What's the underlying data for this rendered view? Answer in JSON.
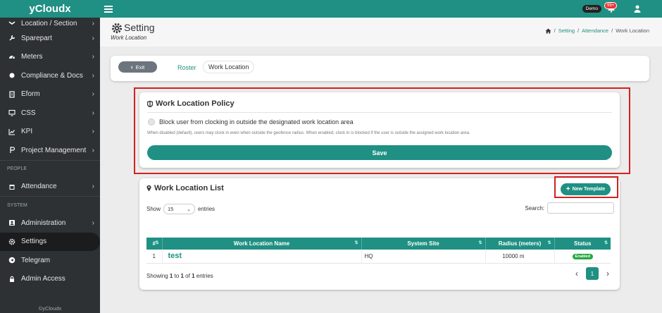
{
  "app": {
    "brand": "yCloudx",
    "copyright": "©yCloudx"
  },
  "topbar": {
    "demo_label": "Demo",
    "notif_count": "99+"
  },
  "sidebar": {
    "items": [
      {
        "label": "Location / Section",
        "icon": "layers-icon"
      },
      {
        "label": "Sparepart",
        "icon": "wrench-icon"
      },
      {
        "label": "Meters",
        "icon": "gauge-icon"
      },
      {
        "label": "Compliance & Docs",
        "icon": "circle-icon"
      },
      {
        "label": "Eform",
        "icon": "form-icon"
      },
      {
        "label": "CSS",
        "icon": "monitor-icon"
      },
      {
        "label": "KPI",
        "icon": "chart-icon"
      },
      {
        "label": "Project Management",
        "icon": "project-icon"
      }
    ],
    "section_people": "PEOPLE",
    "attendance": "Attendance",
    "section_system": "SYSTEM",
    "system_items": [
      {
        "label": "Administration"
      },
      {
        "label": "Settings"
      },
      {
        "label": "Telegram"
      },
      {
        "label": "Admin Access"
      }
    ]
  },
  "page": {
    "title": "Setting",
    "subtitle": "Work Location",
    "breadcrumbs": [
      "Setting",
      "Attendance",
      "Work Location"
    ]
  },
  "tabs": {
    "exit": "Exit",
    "roster": "Roster",
    "work_location": "Work Location"
  },
  "policy": {
    "title": "Work Location Policy",
    "radio_label": "Block user from clocking in outside the designated work location area",
    "hint": "When disabled (default), users may clock in even when outside the geofence radius. When enabled, clock in is blocked if the user is outside the assigned work location area.",
    "save": "Save"
  },
  "list": {
    "title": "Work Location List",
    "new_template": "New Template",
    "show": "Show",
    "entries_value": "15",
    "entries": "entries",
    "search": "Search:",
    "columns": [
      "#",
      "Work Location Name",
      "System Site",
      "Radius (meters)",
      "Status"
    ],
    "rows": [
      {
        "num": "1",
        "name": "test",
        "site": "HQ",
        "radius": "10000 m",
        "status": "Enabled"
      }
    ],
    "showing_pre": "Showing ",
    "showing_from": "1",
    "showing_mid1": " to ",
    "showing_to": "1",
    "showing_mid2": " of ",
    "showing_total": "1",
    "showing_post": " entries",
    "page": "1"
  },
  "colors": {
    "accent": "#1f9083",
    "sidebar": "#2d3133",
    "highlight": "#d62020"
  }
}
